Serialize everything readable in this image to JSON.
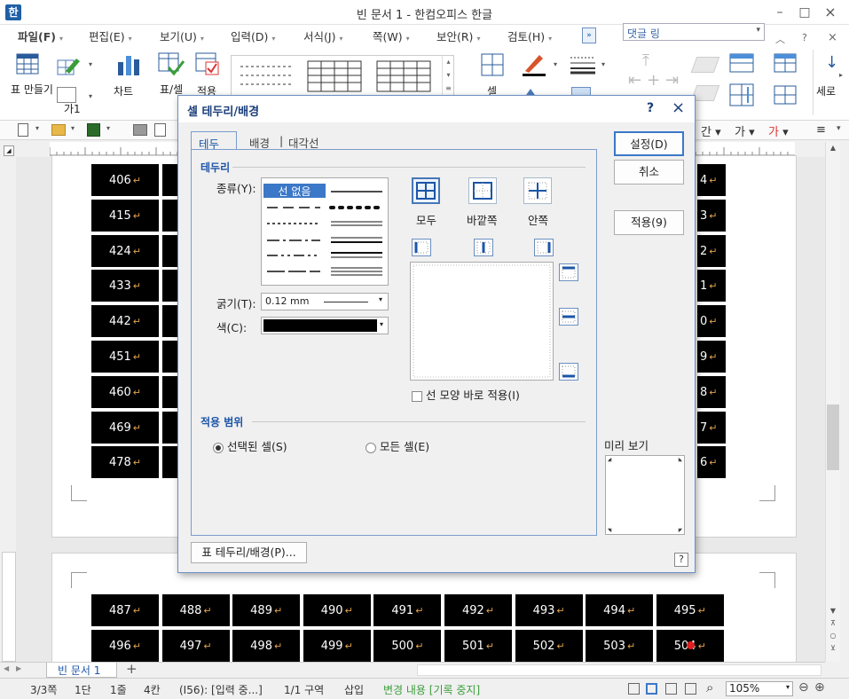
{
  "window": {
    "title": "빈 문서 1 - 한컴오피스 한글",
    "app_icon_glyph": "한",
    "controls": [
      "–",
      "□",
      "×"
    ]
  },
  "menubar": {
    "items": [
      "파일(F)",
      "편집(E)",
      "보기(U)",
      "입력(D)",
      "서식(J)",
      "쪽(W)",
      "보안(R)",
      "검토(H)"
    ],
    "style_combo_value": "댓글 링",
    "right_icons": [
      "^",
      "?",
      "×"
    ]
  },
  "ribbon": {
    "make_table": "표 만들기",
    "chart": "차트",
    "table_cell_props": "표/셀 속성",
    "apply": "적용",
    "cell": "셀",
    "text_style": "가1",
    "vertical": "세로"
  },
  "document": {
    "rows_page1": [
      [
        "406",
        "4"
      ],
      [
        "415",
        "3"
      ],
      [
        "424",
        "2"
      ],
      [
        "433",
        "1"
      ],
      [
        "442",
        "0"
      ],
      [
        "451",
        "9"
      ],
      [
        "460",
        "8"
      ],
      [
        "469",
        "7"
      ],
      [
        "478",
        "6"
      ]
    ],
    "rows_page2": [
      [
        "487",
        "488",
        "489",
        "490",
        "491",
        "492",
        "493",
        "494",
        "495"
      ],
      [
        "496",
        "497",
        "498",
        "499",
        "500",
        "501",
        "502",
        "503",
        "504"
      ]
    ],
    "return_mark": "↵",
    "tab_name": "빈 문서 1"
  },
  "dialog": {
    "title": "셀 테두리/배경",
    "help": "?",
    "close": "×",
    "tabs": [
      "테두리",
      "배경",
      "대각선"
    ],
    "border_group": "테두리",
    "type_label": "종류(Y):",
    "line_none": "선 없음",
    "width_label": "굵기(T):",
    "width_value": "0.12 mm",
    "color_label": "색(C):",
    "color_value": "#000000",
    "presets": [
      "모두",
      "바깥쪽",
      "안쪽"
    ],
    "apply_immediately": "선 모양 바로 적용(I)",
    "scope_group": "적용 범위",
    "scope_selected": "선택된 셀(S)",
    "scope_all": "모든 셀(E)",
    "preview_label": "미리 보기",
    "btn_ok": "설정(D)",
    "btn_cancel": "취소",
    "btn_apply": "적용(9)",
    "btn_table_border": "표 테두리/배경(P)...",
    "help_glyph": "?"
  },
  "statusbar": {
    "page": "3/3쪽",
    "column": "1단",
    "line": "1줄",
    "col": "4칸",
    "cell_info": "(I56): [입력 중...]",
    "section": "1/1 구역",
    "insert": "삽입",
    "track": "변경 내용 [기록 중지]",
    "zoom": "105%"
  }
}
